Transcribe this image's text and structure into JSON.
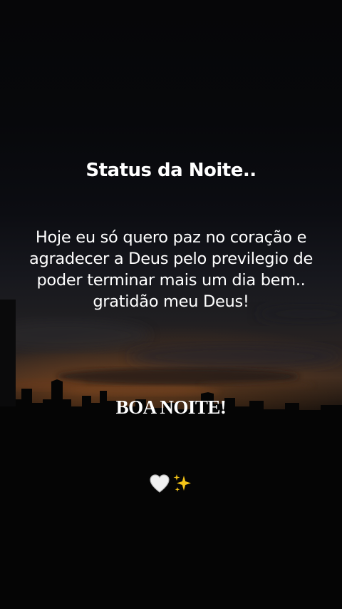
{
  "title": "Status da Noite..",
  "message": "Hoje eu só quero paz no coração e agradecer a Deus pelo previlegio de poder terminar mais um dia bem.. gratidão meu Deus!",
  "greeting": "BOA NOITE!",
  "emojis": [
    "white-heart-icon",
    "sparkles-icon"
  ],
  "colors": {
    "text": "#ffffff",
    "sunset_glow": "#c0642a",
    "sky_dark": "#060608",
    "sparkle": "#f5c518"
  }
}
